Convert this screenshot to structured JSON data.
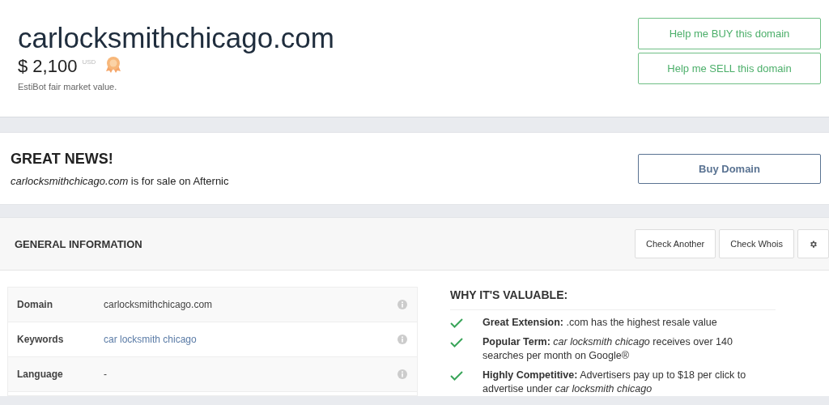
{
  "header": {
    "domain": "carlocksmithchicago.com",
    "price": "$ 2,100",
    "currency": "USD",
    "note": "EstiBot fair market value.",
    "buttons": [
      "Help me BUY this domain",
      "Help me SELL this domain"
    ]
  },
  "news": {
    "title": "GREAT NEWS!",
    "text": "*carlocksmithchicago.com* is for sale on Afternic",
    "button": "Buy Domain"
  },
  "general": {
    "title": "GENERAL INFORMATION",
    "buttons": [
      "Check Another",
      "Check Whois"
    ],
    "rows": [
      {
        "label": "Domain",
        "value": "carlocksmithchicago.com",
        "kind": "text"
      },
      {
        "label": "Keywords",
        "value": "car locksmith chicago",
        "kind": "link"
      },
      {
        "label": "Language",
        "value": "-",
        "kind": "text"
      }
    ]
  },
  "valuable": {
    "title": "WHY IT'S VALUABLE:",
    "items": [
      "**Great Extension:** .com has the highest resale value",
      "**Popular Term:** *car locksmith chicago* receives over 140 searches per month on Google®",
      "**Highly Competitive:** Advertisers pay up to $18 per click to advertise under *car locksmith chicago*"
    ]
  }
}
